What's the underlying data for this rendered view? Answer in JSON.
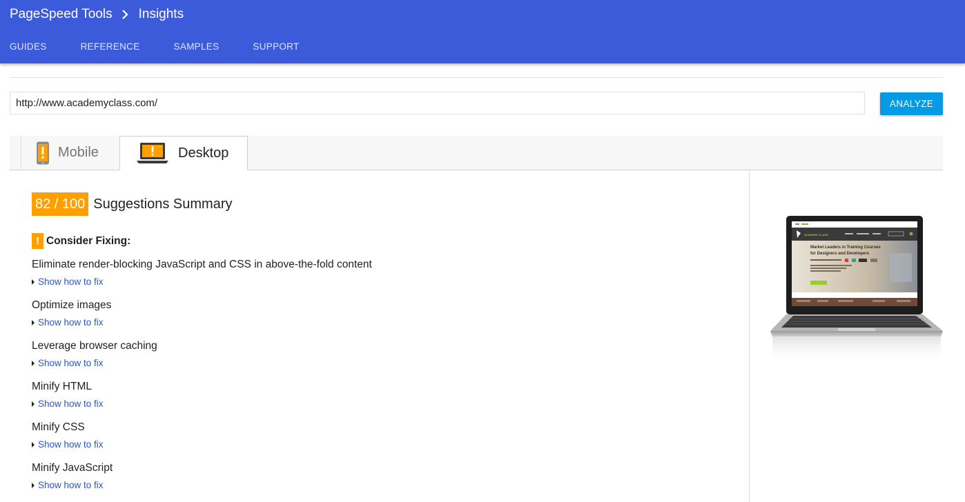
{
  "header": {
    "breadcrumb": {
      "root": "PageSpeed Tools",
      "current": "Insights"
    },
    "nav": [
      "GUIDES",
      "REFERENCE",
      "SAMPLES",
      "SUPPORT"
    ],
    "color": "#3b5bdb"
  },
  "url_input": {
    "value": "http://www.academyclass.com/"
  },
  "analyze_button": {
    "label": "ANALYZE",
    "color": "#039be5"
  },
  "tabs": [
    {
      "label": "Mobile",
      "icon": "phone-warning-icon",
      "selected": false
    },
    {
      "label": "Desktop",
      "icon": "laptop-warning-icon",
      "selected": true
    }
  ],
  "summary": {
    "score": "82 / 100",
    "title": "Suggestions Summary",
    "score_color": "#ffa000"
  },
  "consider_fixing": {
    "badge": "!",
    "title": "Consider Fixing:",
    "rules": [
      {
        "title": "Eliminate render-blocking JavaScript and CSS in above-the-fold content",
        "link": "Show how to fix"
      },
      {
        "title": "Optimize images",
        "link": "Show how to fix"
      },
      {
        "title": "Leverage browser caching",
        "link": "Show how to fix"
      },
      {
        "title": "Minify HTML",
        "link": "Show how to fix"
      },
      {
        "title": "Minify CSS",
        "link": "Show how to fix"
      },
      {
        "title": "Minify JavaScript",
        "link": "Show how to fix"
      }
    ]
  },
  "preview": {
    "site_name": "ACADEMY CLASS",
    "headline_1": "Market Leaders in Training Courses",
    "headline_2": "for Designers and Developers"
  }
}
